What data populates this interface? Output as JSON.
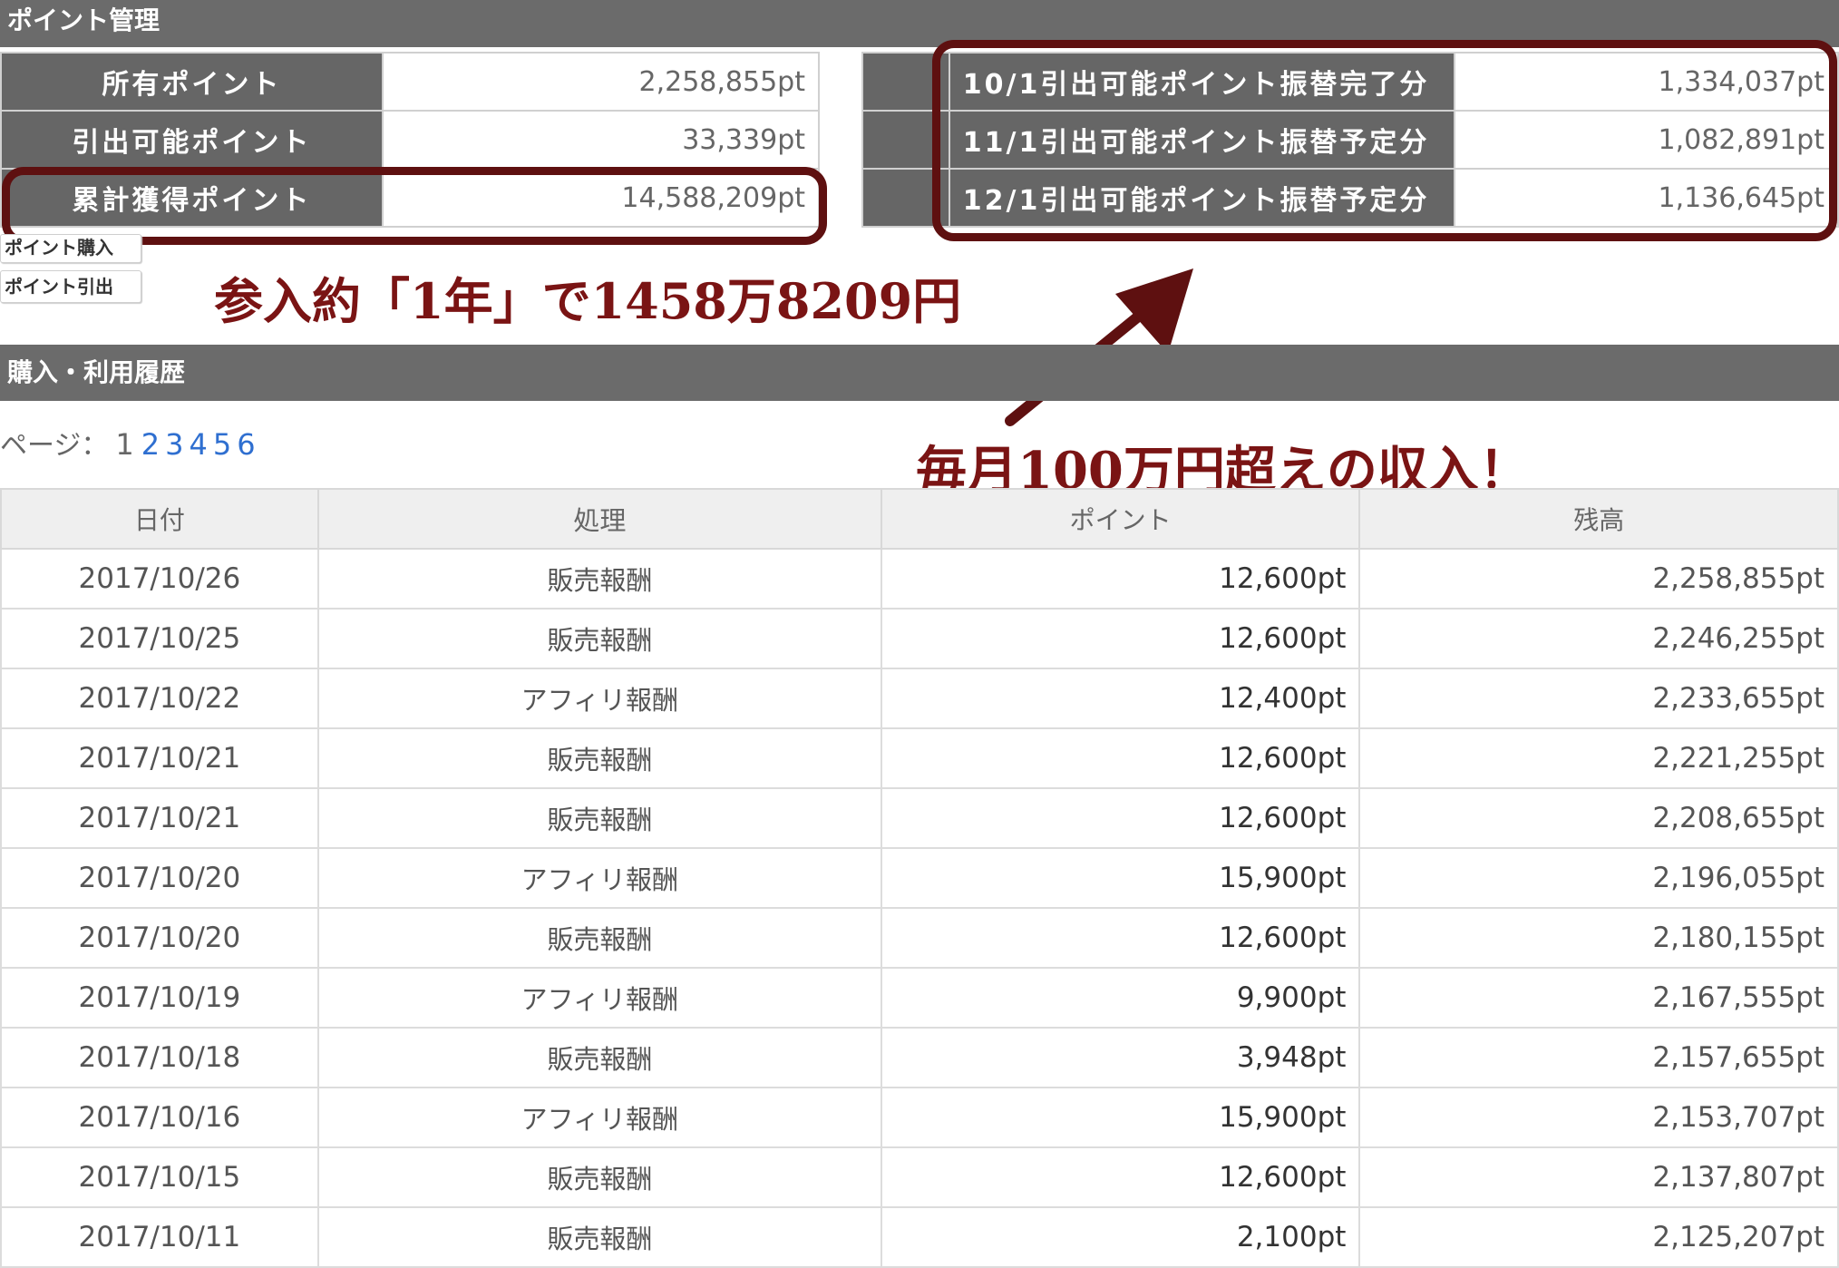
{
  "header": {
    "title": "ポイント管理"
  },
  "summary_left": [
    {
      "label": "所有ポイント",
      "value": "2,258,855pt"
    },
    {
      "label": "引出可能ポイント",
      "value": "33,339pt"
    },
    {
      "label": "累計獲得ポイント",
      "value": "14,588,209pt"
    }
  ],
  "summary_right": [
    {
      "label": "10/1引出可能ポイント振替完了分",
      "value": "1,334,037pt"
    },
    {
      "label": "11/1引出可能ポイント振替予定分",
      "value": "1,082,891pt"
    },
    {
      "label": "12/1引出可能ポイント振替予定分",
      "value": "1,136,645pt"
    }
  ],
  "buttons": {
    "buy": "ポイント購入",
    "withdraw": "ポイント引出"
  },
  "annotations": {
    "total_note": "参入約「1年」で1458万8209円",
    "monthly_note": "毎月100万円超えの収入！",
    "accent_color": "#7a1414"
  },
  "history": {
    "title": "購入・利用履歴",
    "pager_label": "ページ：",
    "current_page": "1",
    "pages": [
      "2",
      "3",
      "4",
      "5",
      "6"
    ],
    "columns": [
      "日付",
      "処理",
      "ポイント",
      "残高"
    ],
    "rows": [
      [
        "2017/10/26",
        "販売報酬",
        "12,600pt",
        "2,258,855pt"
      ],
      [
        "2017/10/25",
        "販売報酬",
        "12,600pt",
        "2,246,255pt"
      ],
      [
        "2017/10/22",
        "アフィリ報酬",
        "12,400pt",
        "2,233,655pt"
      ],
      [
        "2017/10/21",
        "販売報酬",
        "12,600pt",
        "2,221,255pt"
      ],
      [
        "2017/10/21",
        "販売報酬",
        "12,600pt",
        "2,208,655pt"
      ],
      [
        "2017/10/20",
        "アフィリ報酬",
        "15,900pt",
        "2,196,055pt"
      ],
      [
        "2017/10/20",
        "販売報酬",
        "12,600pt",
        "2,180,155pt"
      ],
      [
        "2017/10/19",
        "アフィリ報酬",
        "9,900pt",
        "2,167,555pt"
      ],
      [
        "2017/10/18",
        "販売報酬",
        "3,948pt",
        "2,157,655pt"
      ],
      [
        "2017/10/16",
        "アフィリ報酬",
        "15,900pt",
        "2,153,707pt"
      ],
      [
        "2017/10/15",
        "販売報酬",
        "12,600pt",
        "2,137,807pt"
      ],
      [
        "2017/10/11",
        "販売報酬",
        "2,100pt",
        "2,125,207pt"
      ]
    ]
  }
}
